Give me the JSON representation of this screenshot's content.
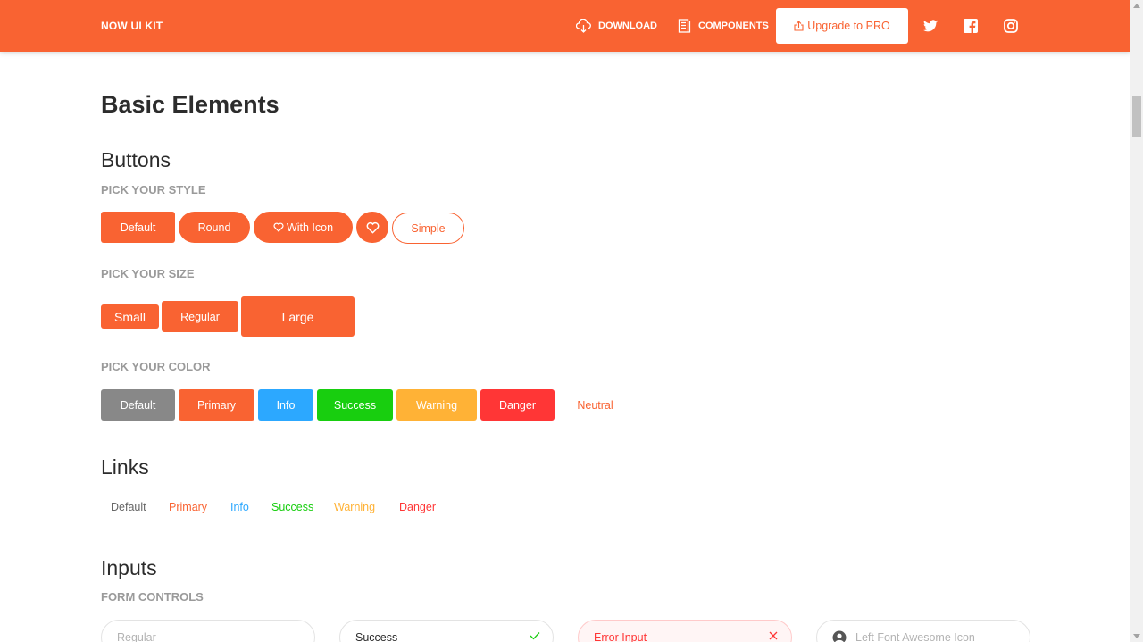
{
  "navbar": {
    "brand": "NOW UI KIT",
    "download": "DOWNLOAD",
    "components": "COMPONENTS",
    "upgrade": "Upgrade to PRO",
    "social_icons": [
      "twitter-icon",
      "facebook-icon",
      "instagram-icon"
    ]
  },
  "page": {
    "title": "Basic Elements"
  },
  "buttons": {
    "heading": "Buttons",
    "style_label": "PICK YOUR STYLE",
    "style": {
      "default": "Default",
      "round": "Round",
      "with_icon": "With Icon",
      "simple": "Simple"
    },
    "size_label": "PICK YOUR SIZE",
    "size": {
      "small": "Small",
      "regular": "Regular",
      "large": "Large"
    },
    "color_label": "PICK YOUR COLOR",
    "color": [
      {
        "label": "Default",
        "color": "#888888"
      },
      {
        "label": "Primary",
        "color": "#f96332"
      },
      {
        "label": "Info",
        "color": "#2ca8ff"
      },
      {
        "label": "Success",
        "color": "#18ce0f"
      },
      {
        "label": "Warning",
        "color": "#ffb236"
      },
      {
        "label": "Danger",
        "color": "#ff3636"
      },
      {
        "label": "Neutral",
        "color": "#f96332"
      }
    ]
  },
  "links": {
    "heading": "Links",
    "items": [
      {
        "label": "Default",
        "color": "#666666"
      },
      {
        "label": "Primary",
        "color": "#f96332"
      },
      {
        "label": "Info",
        "color": "#2ca8ff"
      },
      {
        "label": "Success",
        "color": "#18ce0f"
      },
      {
        "label": "Warning",
        "color": "#ffb236"
      },
      {
        "label": "Danger",
        "color": "#ff3636"
      }
    ]
  },
  "inputs": {
    "heading": "Inputs",
    "form_label": "FORM CONTROLS",
    "regular_placeholder": "Regular",
    "success_value": "Success",
    "error_value": "Error Input",
    "icon_placeholder": "Left Font Awesome Icon"
  },
  "colors": {
    "primary": "#f96332",
    "text": "#2c2c2c",
    "muted": "#9a9a9a"
  }
}
